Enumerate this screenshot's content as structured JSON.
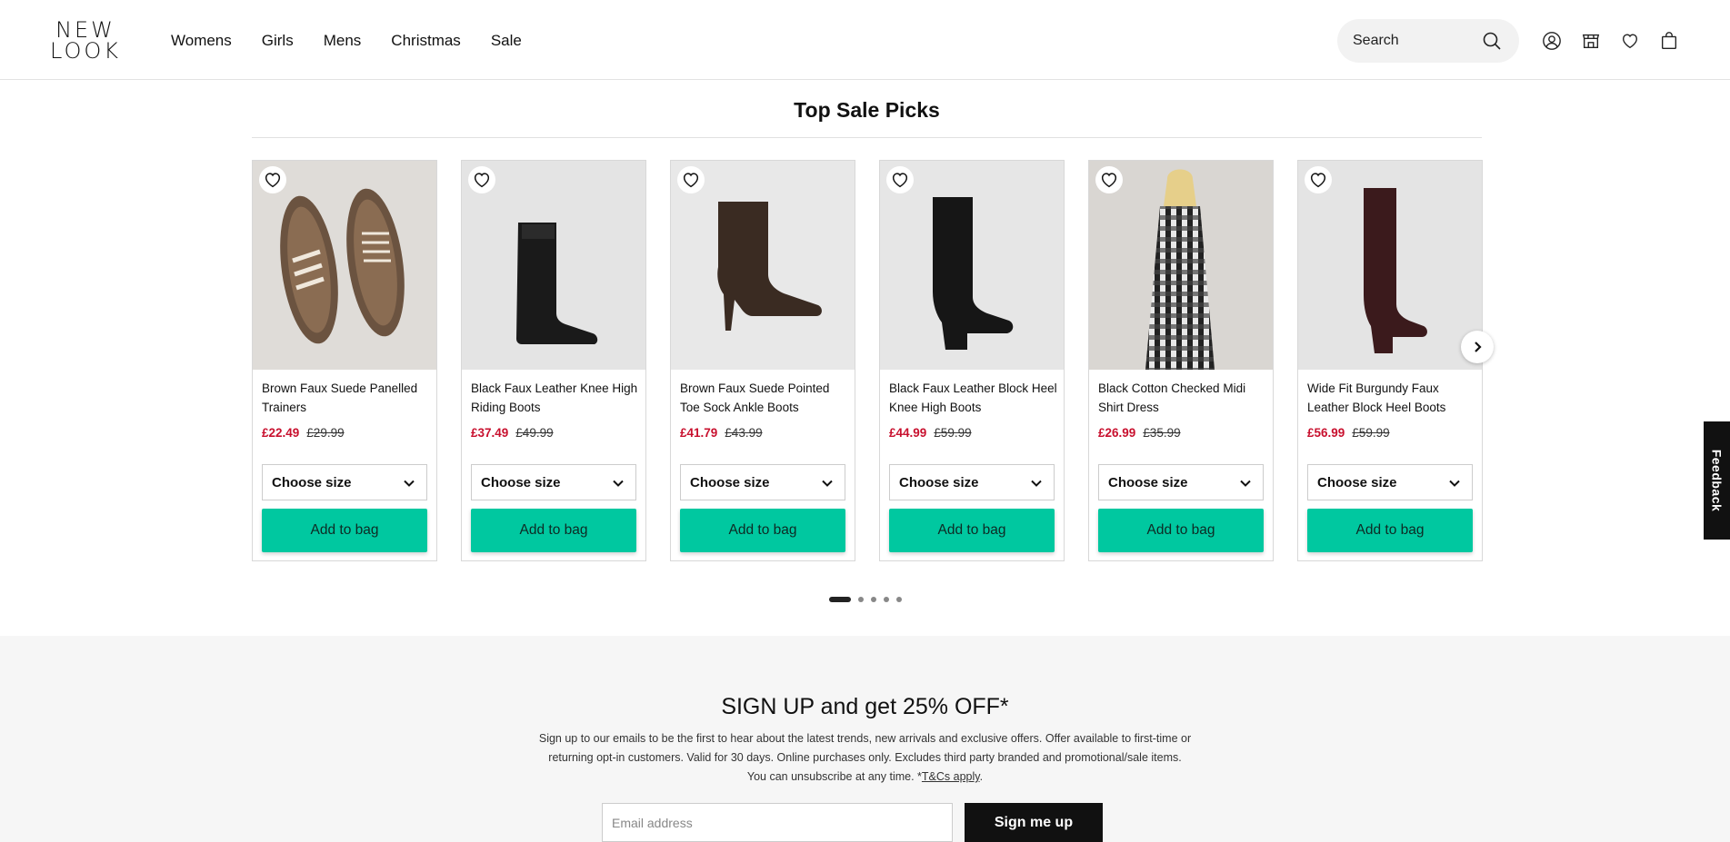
{
  "header": {
    "logo_line1": "NEW",
    "logo_line2": "LOOK",
    "nav": [
      "Womens",
      "Girls",
      "Mens",
      "Christmas",
      "Sale"
    ],
    "search_placeholder": "Search",
    "icons": [
      "account-icon",
      "store-icon",
      "wishlist-icon",
      "bag-icon"
    ]
  },
  "section": {
    "title": "Top Sale Picks"
  },
  "products": [
    {
      "name": "Brown Faux Suede Panelled Trainers",
      "price_now": "£22.49",
      "price_was": "£29.99",
      "size_label": "Choose size",
      "add_label": "Add to bag"
    },
    {
      "name": "Black Faux Leather Knee High Riding Boots",
      "price_now": "£37.49",
      "price_was": "£49.99",
      "size_label": "Choose size",
      "add_label": "Add to bag"
    },
    {
      "name": "Brown Faux Suede Pointed Toe Sock Ankle Boots",
      "price_now": "£41.79",
      "price_was": "£43.99",
      "size_label": "Choose size",
      "add_label": "Add to bag"
    },
    {
      "name": "Black Faux Leather Block Heel Knee High Boots",
      "price_now": "£44.99",
      "price_was": "£59.99",
      "size_label": "Choose size",
      "add_label": "Add to bag"
    },
    {
      "name": "Black Cotton Checked Midi Shirt Dress",
      "price_now": "£26.99",
      "price_was": "£35.99",
      "size_label": "Choose size",
      "add_label": "Add to bag"
    },
    {
      "name": "Wide Fit Burgundy Faux Leather Block Heel Boots",
      "price_now": "£56.99",
      "price_was": "£59.99",
      "size_label": "Choose size",
      "add_label": "Add to bag"
    }
  ],
  "carousel": {
    "page_count": 5,
    "active_page": 1
  },
  "feedback_label": "Feedback",
  "signup": {
    "title": "SIGN UP and get 25% OFF*",
    "desc_line1": "Sign up to our emails to be the first to hear about the latest trends, new arrivals and exclusive offers. Offer available to first-time or",
    "desc_line2": "returning opt-in customers. Valid for 30 days. Online purchases only. Excludes third party branded and promotional/sale items.",
    "desc_line3": "You can unsubscribe at any time. *",
    "tcs_link": "T&Cs apply",
    "desc_end": ".",
    "email_placeholder": "Email address",
    "submit_label": "Sign me up"
  },
  "colors": {
    "sale_red": "#c8102e",
    "add_button": "#00c8a0"
  }
}
